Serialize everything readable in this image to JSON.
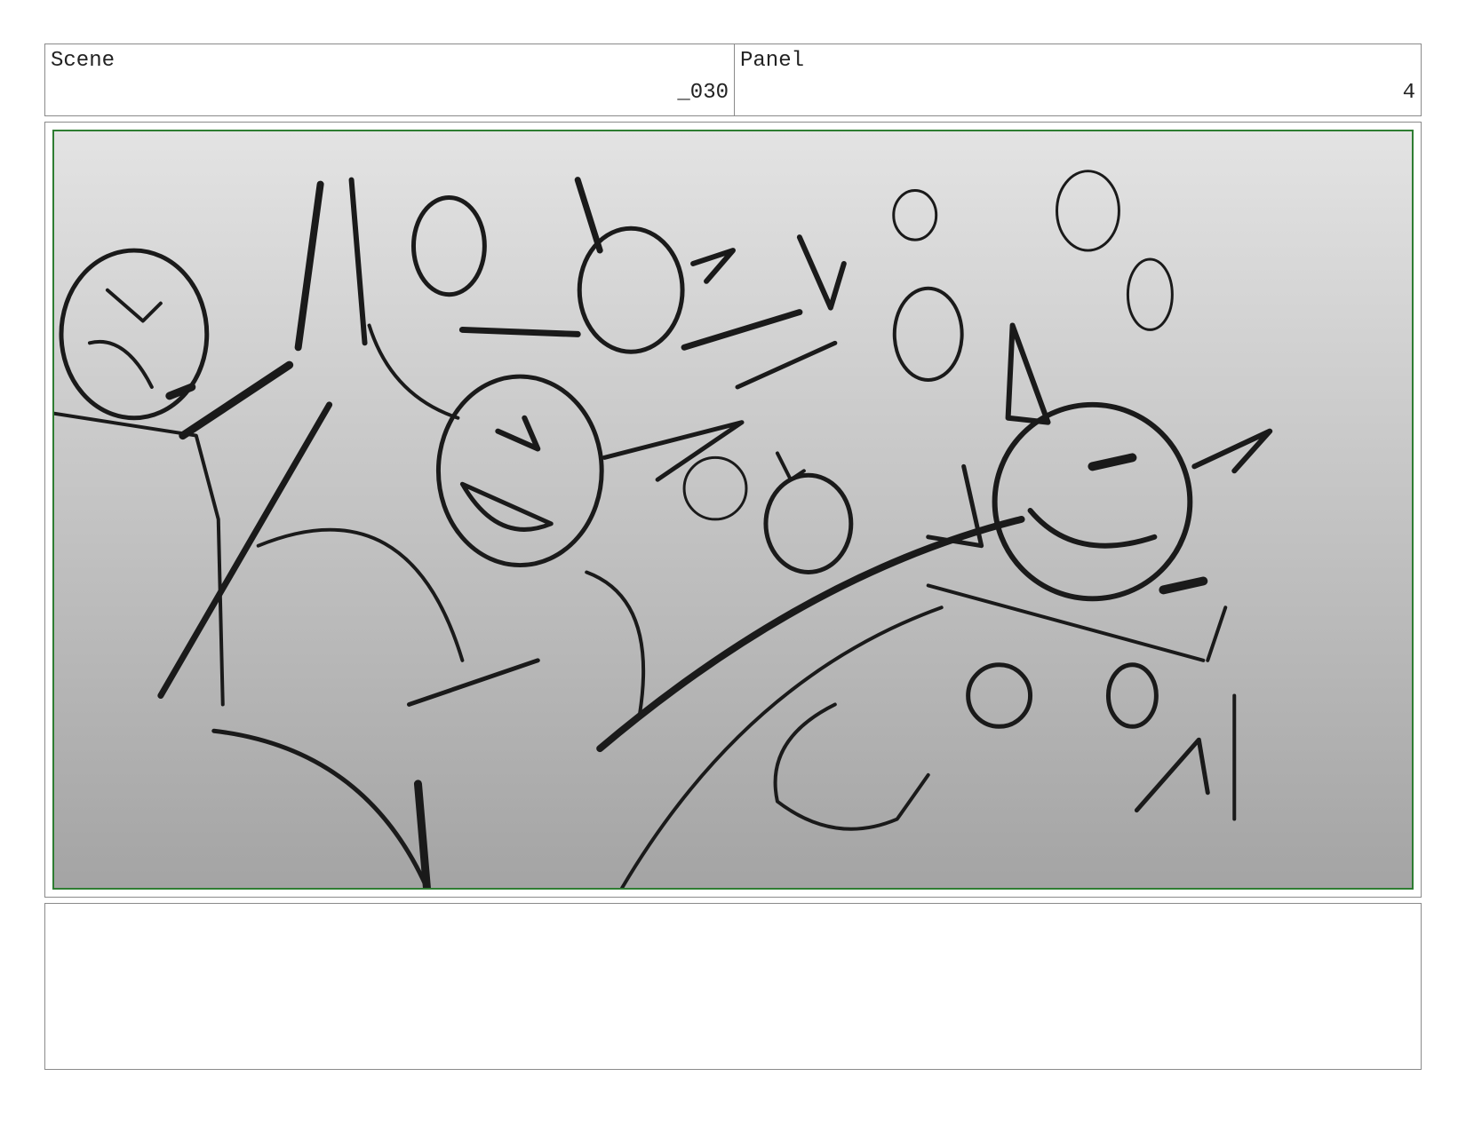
{
  "header": {
    "scene": {
      "label": "Scene",
      "value": "_030"
    },
    "panel": {
      "label": "Panel",
      "value": "4"
    }
  },
  "frame": {
    "accent_color": "#2e7d32",
    "content": "sketch-drawing"
  },
  "notes": {
    "text": ""
  }
}
